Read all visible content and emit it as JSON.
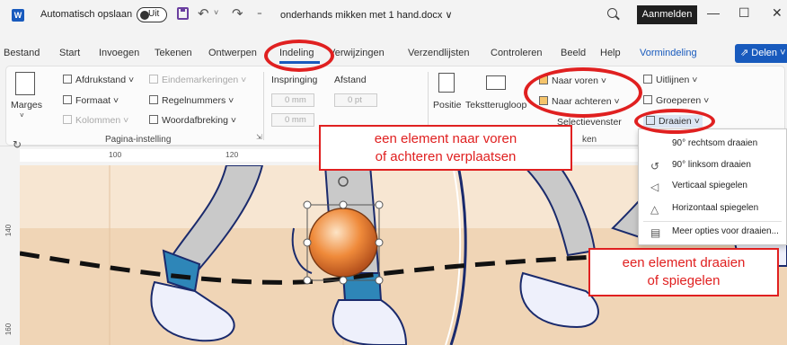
{
  "titlebar": {
    "autosave_label": "Automatisch opslaan",
    "autosave_state": "Uit",
    "doc_title": "onderhands mikken met 1 hand.docx ∨",
    "signin": "Aanmelden",
    "minimize": "—",
    "maximize": "☐",
    "close": "✕"
  },
  "tabs": [
    "Bestand",
    "Start",
    "Invoegen",
    "Tekenen",
    "Ontwerpen",
    "Indeling",
    "Verwijzingen",
    "Verzendlijsten",
    "Controleren",
    "Beeld",
    "Help",
    "Vormindeling"
  ],
  "active_tab": "Indeling",
  "share": "⇗ Delen ˅",
  "ribbon": {
    "marges": "Marges",
    "afdrukstand": "Afdrukstand ˅",
    "formaat": "Formaat ˅",
    "kolommen": "Kolommen ˅",
    "eindemarkeringen": "Eindemarkeringen ˅",
    "regelnummers": "Regelnummers ˅",
    "woordafbreking": "Woordafbreking ˅",
    "group_pagina": "Pagina-instelling",
    "inspringing": "Inspringing",
    "afstand": "Afstand",
    "zero_mm_1": "0 mm",
    "zero_mm_2": "0 mm",
    "zero_pt": "0 pt",
    "positie": "Positie",
    "tekstterugloop": "Tekstterugloop",
    "naar_voren": "Naar voren ˅",
    "naar_achteren": "Naar achteren ˅",
    "selectievenster": "Selectievenster",
    "group_schikken": "ken",
    "uitlijnen": "Uitlijnen ˅",
    "groeperen": "Groeperen ˅",
    "draaien": "Draaien ˅"
  },
  "ruler": {
    "h": [
      "100",
      "120"
    ],
    "v": [
      "140",
      "160"
    ]
  },
  "dropdown": {
    "items": [
      {
        "icon": "rotate-right-icon",
        "glyph": "↻",
        "label": "90° rechtsom draaien"
      },
      {
        "icon": "rotate-left-icon",
        "glyph": "↺",
        "label": "90° linksom draaien"
      },
      {
        "icon": "flip-vertical-icon",
        "glyph": "◁",
        "label": "Verticaal spiegelen"
      },
      {
        "icon": "flip-horizontal-icon",
        "glyph": "△",
        "label": "Horizontaal spiegelen"
      },
      {
        "icon": "more-options-icon",
        "glyph": "▤",
        "label": "Meer opties voor draaien..."
      }
    ]
  },
  "callouts": {
    "forward_back": [
      "een element naar voren",
      "of achteren verplaatsen"
    ],
    "rotate_flip": [
      "een element draaien",
      "of spiegelen"
    ]
  },
  "colors": {
    "accent": "#185abd",
    "highlight": "#e02020",
    "canvas": "#f0d5b6"
  }
}
